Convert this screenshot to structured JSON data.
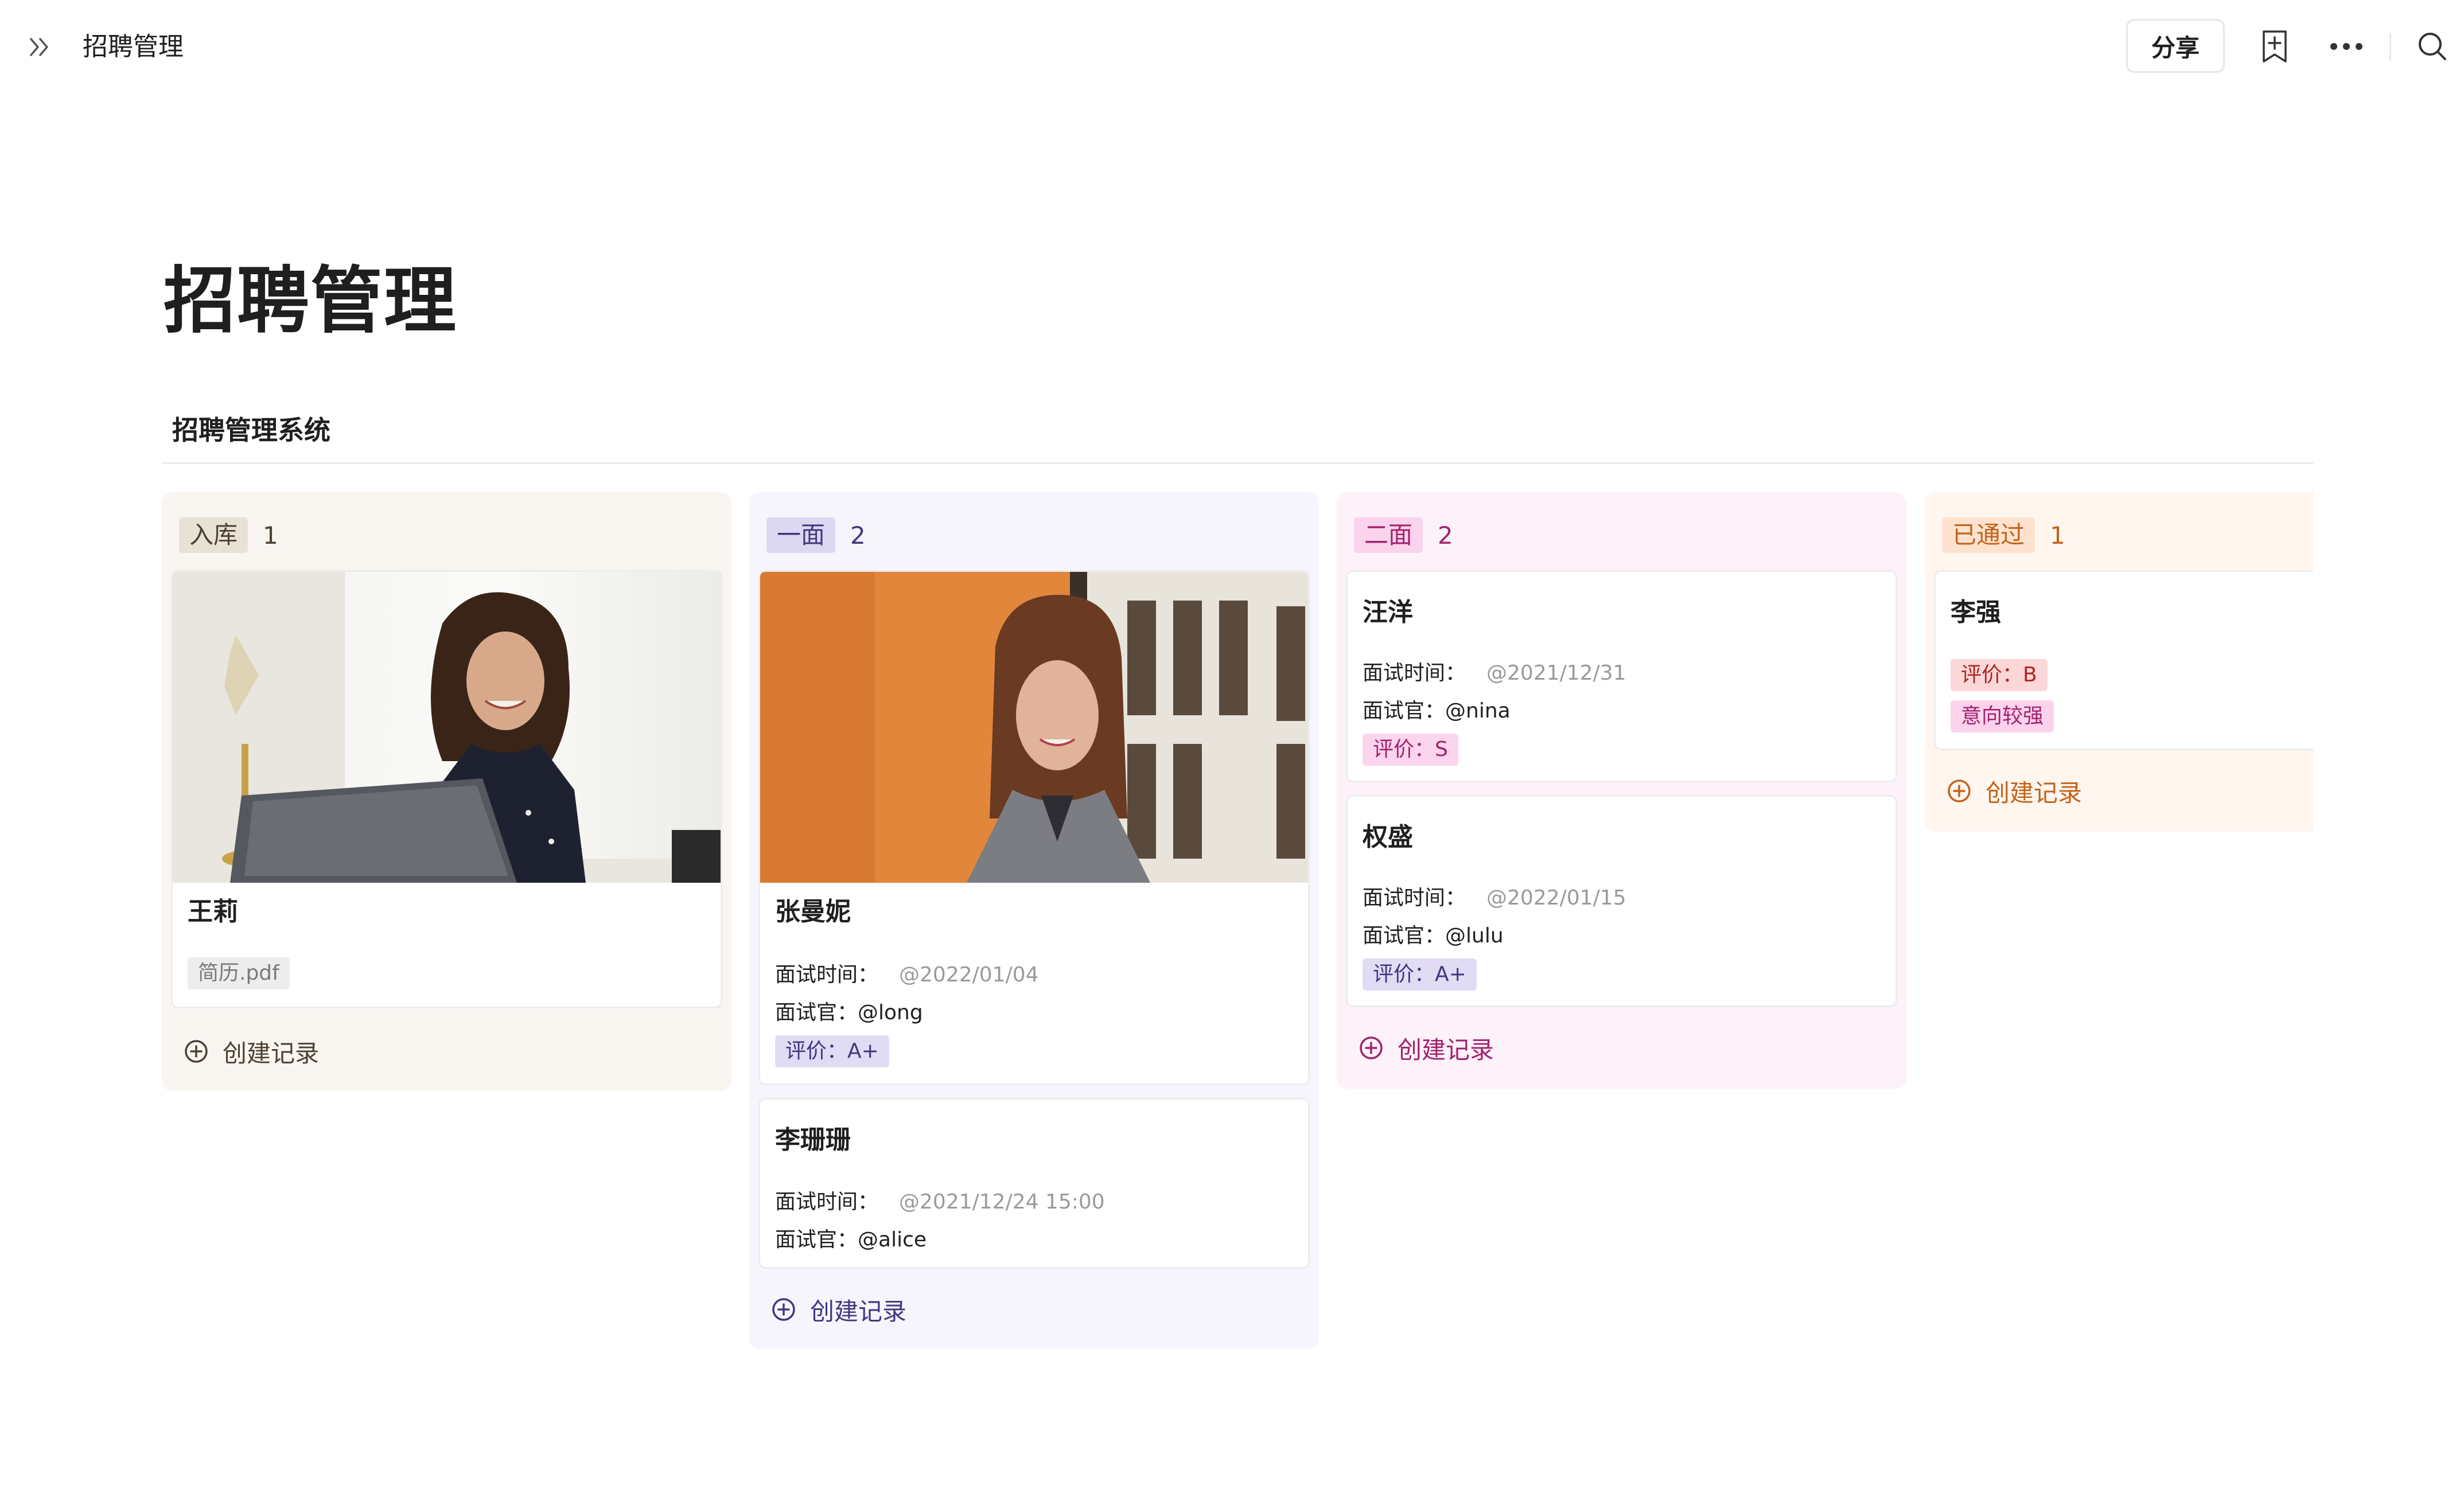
{
  "topbar": {
    "title": "招聘管理",
    "share_label": "分享"
  },
  "page": {
    "title": "招聘管理",
    "view_tab": "招聘管理系统"
  },
  "colors": {
    "col_ruku_bg": "#f9f6f2",
    "tag_ruku_bg": "#e8e1d6",
    "tag_ruku_fg": "#4d4132",
    "col_yimian_bg": "#f6f5fb",
    "tag_yimian_bg": "#ddd8f2",
    "tag_yimian_fg": "#3f3880",
    "col_ermian_bg": "#fdf2fa",
    "tag_ermian_bg": "#fad3ec",
    "tag_ermian_fg": "#a3226e",
    "col_tongguo_bg": "#fff6f0",
    "tag_tongguo_bg": "#fde3cf",
    "tag_tongguo_fg": "#c4631a"
  },
  "columns": [
    {
      "status": "入库",
      "count": "1",
      "create_label": "创建记录",
      "cards": [
        {
          "name": "王莉",
          "attachment": "简历.pdf"
        }
      ]
    },
    {
      "status": "一面",
      "count": "2",
      "create_label": "创建记录",
      "cards": [
        {
          "name": "张曼妮",
          "time_label": "面试时间：",
          "time": "@2022/01/04",
          "interviewer_label": "面试官：",
          "interviewer": "@long",
          "rating": "评价：A+"
        },
        {
          "name": "李珊珊",
          "time_label": "面试时间：",
          "time": "@2021/12/24 15:00",
          "interviewer_label": "面试官：",
          "interviewer": "@alice"
        }
      ]
    },
    {
      "status": "二面",
      "count": "2",
      "create_label": "创建记录",
      "cards": [
        {
          "name": "汪洋",
          "time_label": "面试时间：",
          "time": "@2021/12/31",
          "interviewer_label": "面试官：",
          "interviewer": "@nina",
          "rating": "评价：S"
        },
        {
          "name": "权盛",
          "time_label": "面试时间：",
          "time": "@2022/01/15",
          "interviewer_label": "面试官：",
          "interviewer": "@lulu",
          "rating": "评价：A+"
        }
      ]
    },
    {
      "status": "已通过",
      "count": "1",
      "create_label": "创建记录",
      "cards": [
        {
          "name": "李强",
          "rating": "评价：B",
          "intent": "意向较强"
        }
      ]
    }
  ]
}
